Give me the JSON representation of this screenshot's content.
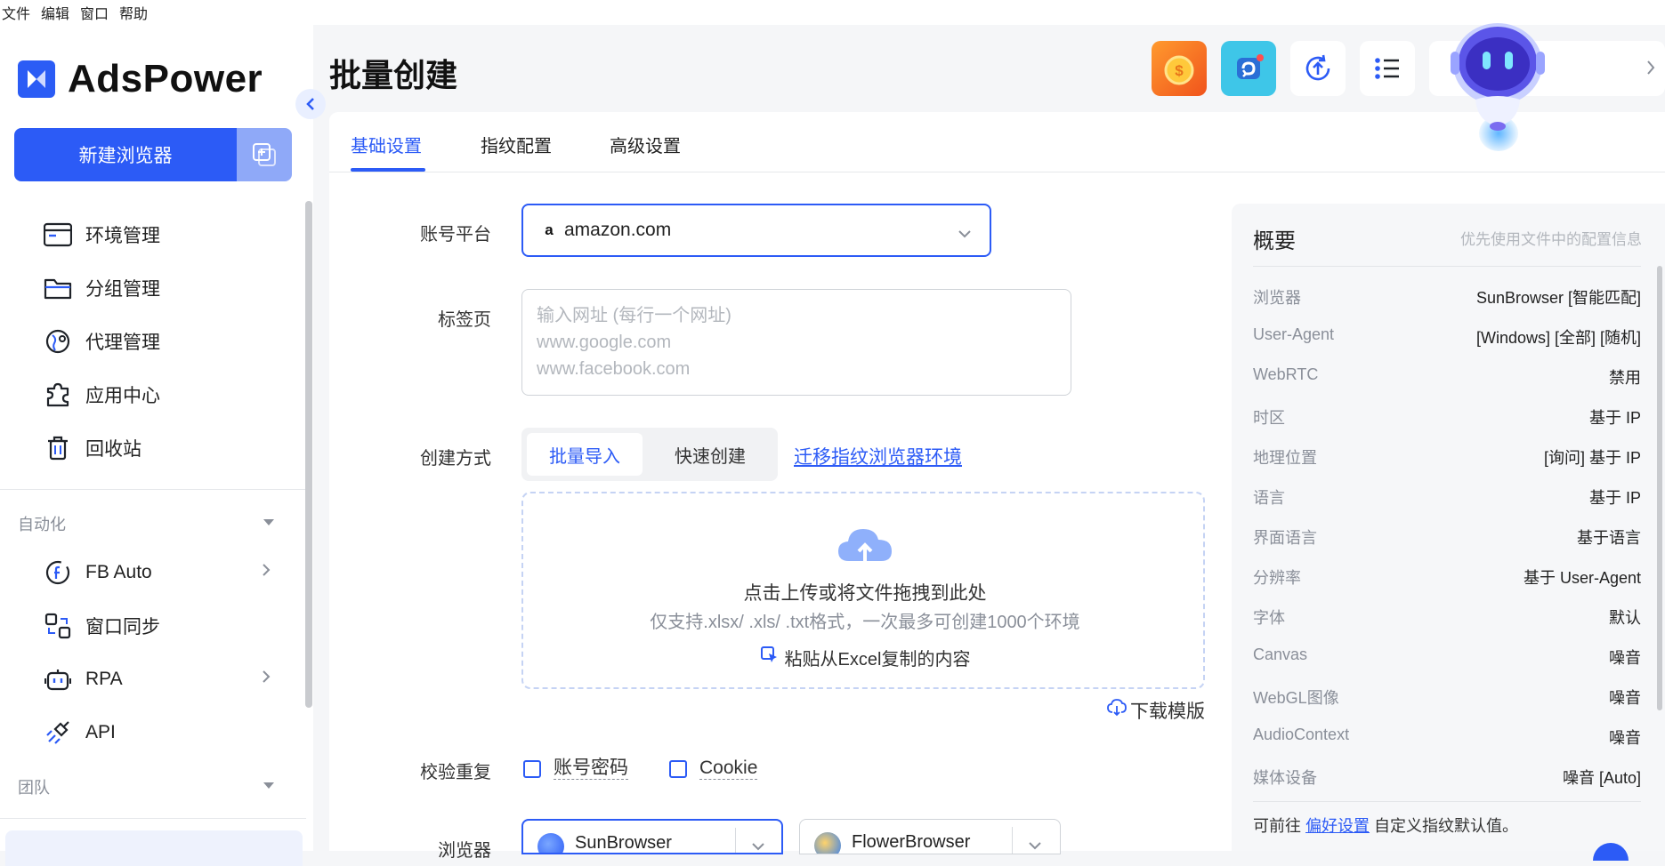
{
  "menubar": {
    "file": "文件",
    "edit": "编辑",
    "window": "窗口",
    "help": "帮助"
  },
  "app": {
    "name": "AdsPower"
  },
  "sidebar": {
    "new_browser": "新建浏览器",
    "items": [
      {
        "label": "环境管理",
        "icon": "browser-window-icon"
      },
      {
        "label": "分组管理",
        "icon": "folder-icon"
      },
      {
        "label": "代理管理",
        "icon": "proxy-globe-icon"
      },
      {
        "label": "应用中心",
        "icon": "puzzle-icon"
      },
      {
        "label": "回收站",
        "icon": "trash-icon"
      }
    ],
    "automation_title": "自动化",
    "automation_items": [
      {
        "label": "FB Auto",
        "icon": "fb-auto-icon"
      },
      {
        "label": "窗口同步",
        "icon": "window-sync-icon"
      },
      {
        "label": "RPA",
        "icon": "robot-icon"
      },
      {
        "label": "API",
        "icon": "api-plug-icon"
      }
    ],
    "team_title": "团队"
  },
  "page": {
    "title": "批量创建"
  },
  "tabs": [
    "基础设置",
    "指纹配置",
    "高级设置"
  ],
  "form": {
    "platform_label": "账号平台",
    "platform_value": "amazon.com",
    "tabs_label": "标签页",
    "tabs_placeholder": [
      "输入网址 (每行一个网址)",
      "www.google.com",
      "www.facebook.com"
    ],
    "method_label": "创建方式",
    "method_batch": "批量导入",
    "method_quick": "快速创建",
    "migrate_link": "迁移指纹浏览器环境",
    "upload_main": "点击上传或将文件拖拽到此处",
    "upload_sub": "仅支持.xlsx/ .xls/ .txt格式，一次最多可创建1000个环境",
    "paste_excel": "粘贴从Excel复制的内容",
    "download_template": "下载模版",
    "dedupe_label": "校验重复",
    "dedupe_account": "账号密码",
    "dedupe_cookie": "Cookie",
    "browser_label": "浏览器",
    "browser_sun": "SunBrowser",
    "browser_flower": "FlowerBrowser"
  },
  "summary": {
    "title": "概要",
    "hint": "优先使用文件中的配置信息",
    "rows": [
      {
        "k": "浏览器",
        "v": "SunBrowser [智能匹配]"
      },
      {
        "k": "User-Agent",
        "v": "[Windows] [全部] [随机]"
      },
      {
        "k": "WebRTC",
        "v": "禁用"
      },
      {
        "k": "时区",
        "v": "基于 IP"
      },
      {
        "k": "地理位置",
        "v": "[询问] 基于 IP"
      },
      {
        "k": "语言",
        "v": "基于 IP"
      },
      {
        "k": "界面语言",
        "v": "基于语言"
      },
      {
        "k": "分辨率",
        "v": "基于 User-Agent"
      },
      {
        "k": "字体",
        "v": "默认"
      },
      {
        "k": "Canvas",
        "v": "噪音"
      },
      {
        "k": "WebGL图像",
        "v": "噪音"
      },
      {
        "k": "AudioContext",
        "v": "噪音"
      },
      {
        "k": "媒体设备",
        "v": "噪音 [Auto]"
      }
    ],
    "foot_prefix": "可前往",
    "foot_link": "偏好设置",
    "foot_suffix": "自定义指纹默认值。"
  },
  "colors": {
    "accent": "#2c5bf6",
    "sidebar_bg": "#ffffff",
    "page_bg": "#f5f6f8"
  }
}
